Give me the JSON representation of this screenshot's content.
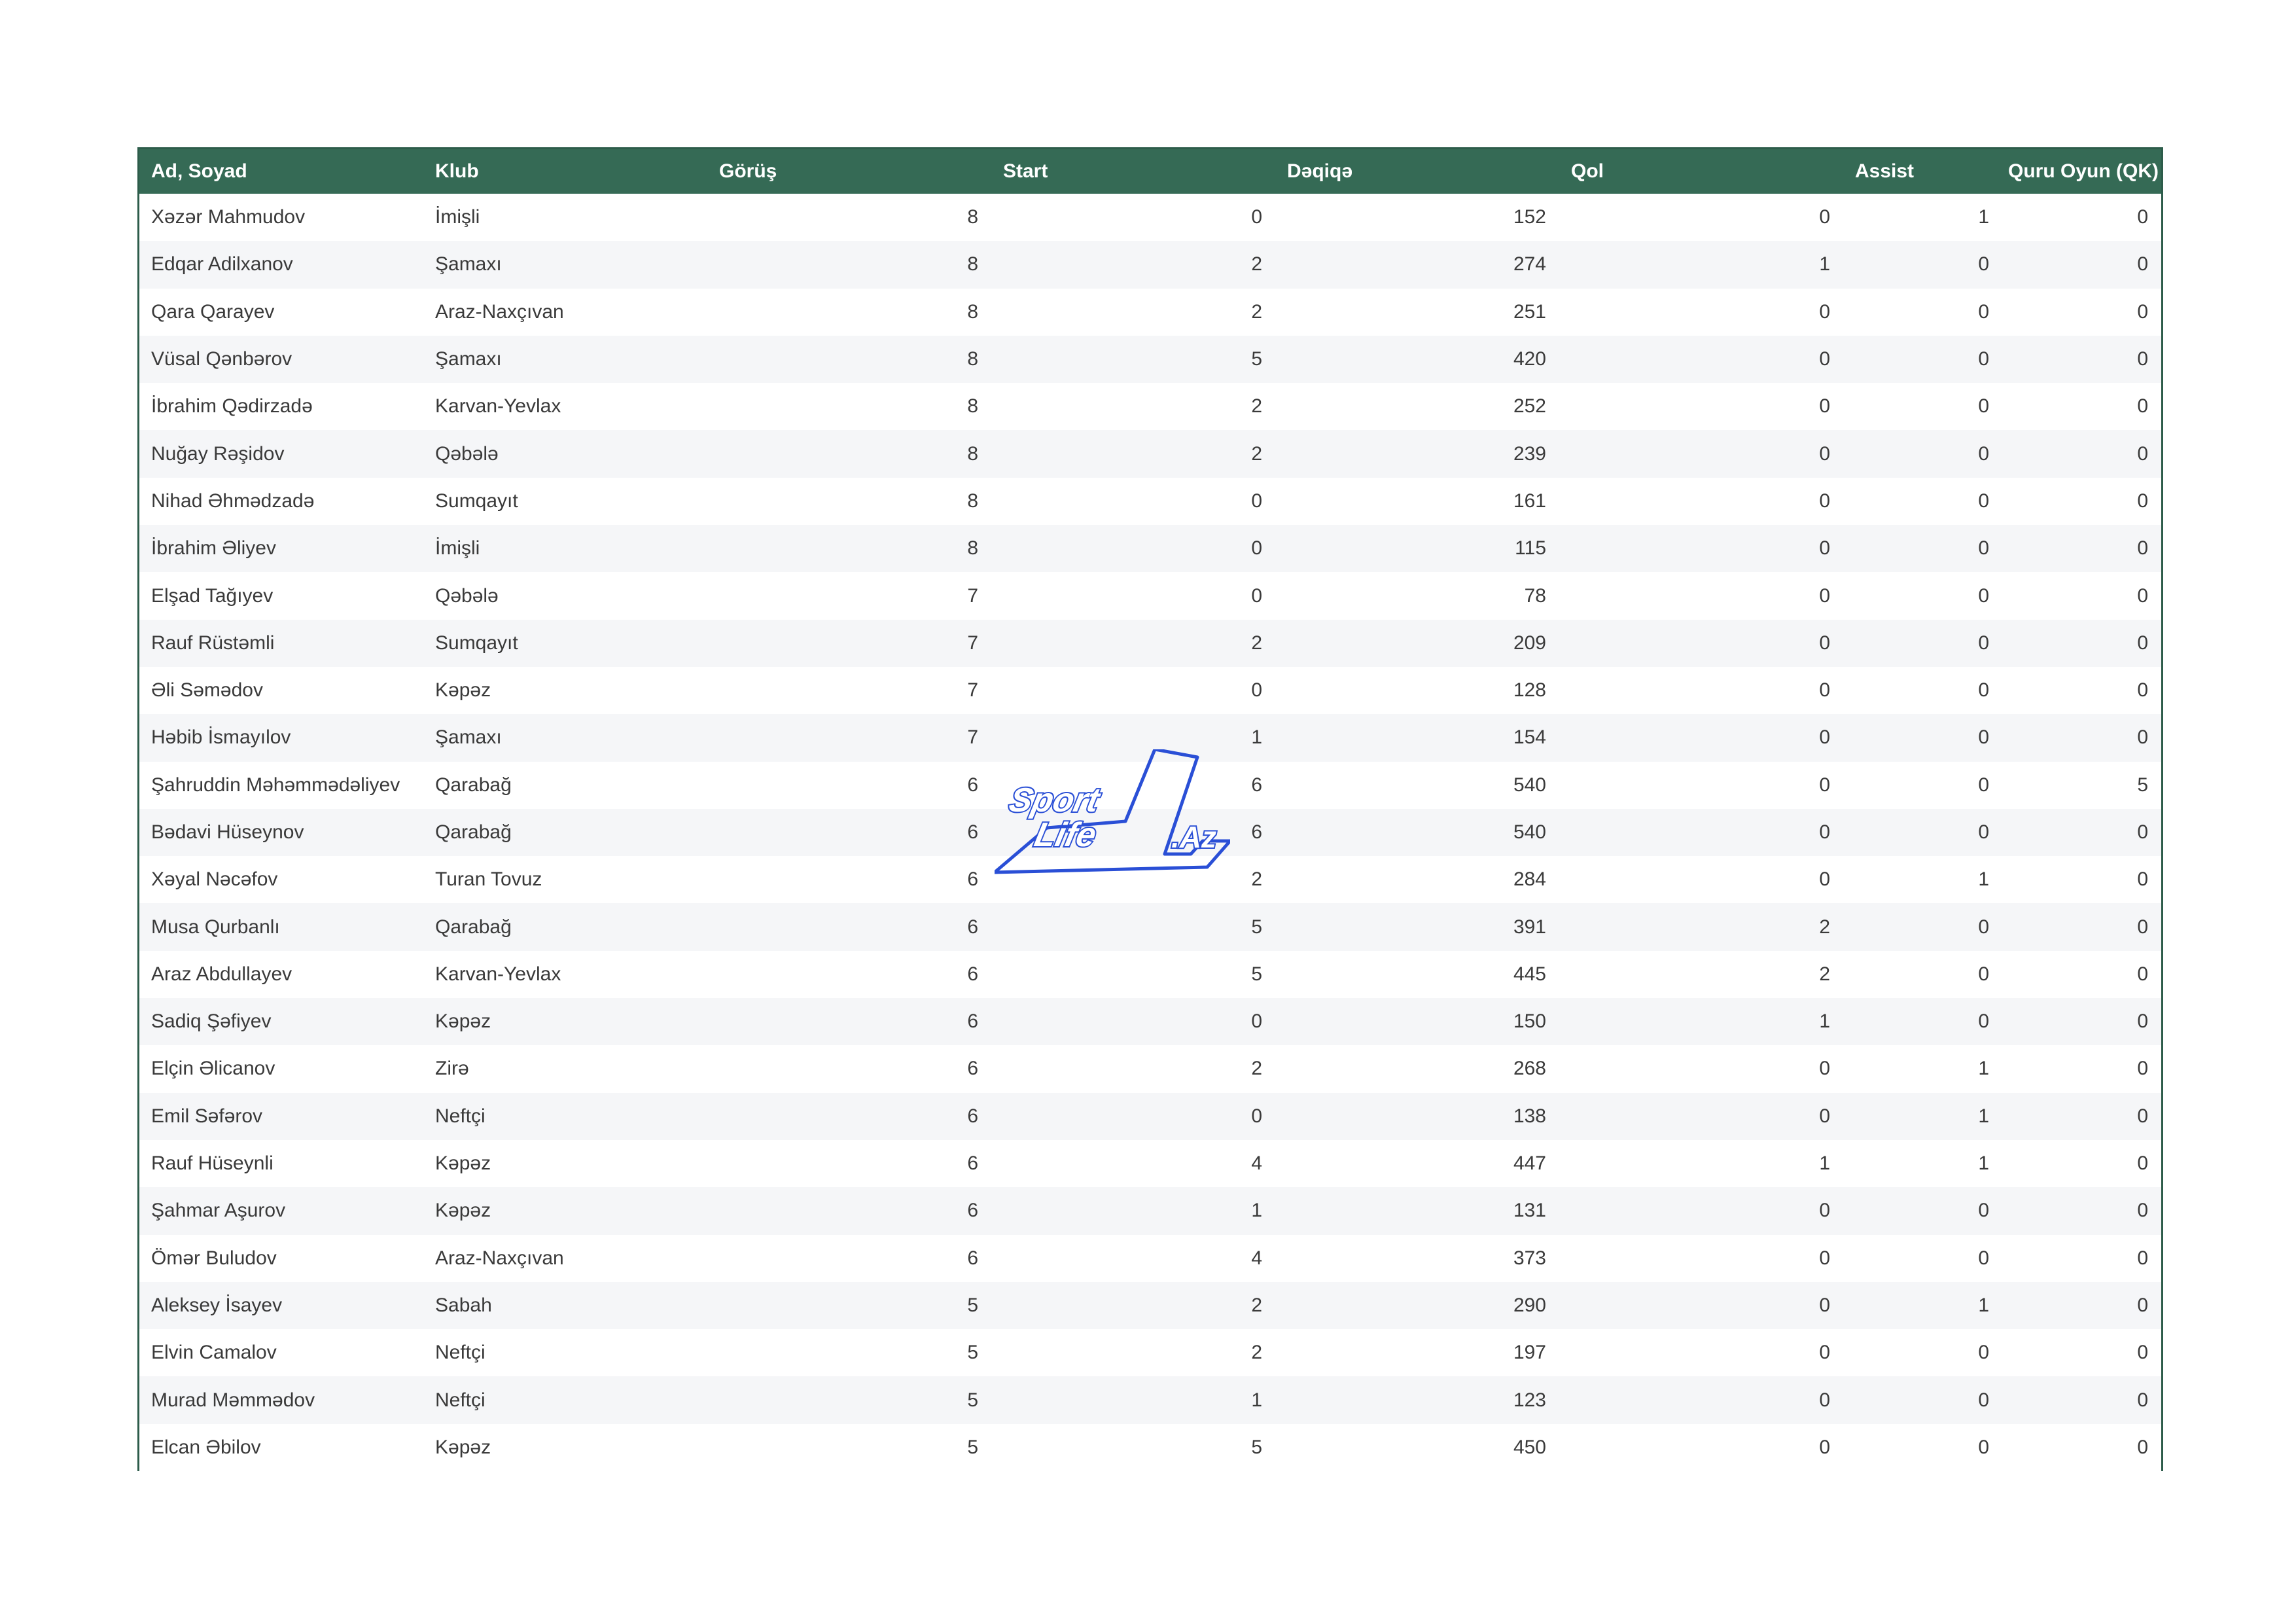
{
  "table": {
    "headers": [
      "Ad, Soyad",
      "Klub",
      "Görüş",
      "Start",
      "Dəqiqə",
      "Qol",
      "Assist",
      "Quru Oyun (QK)"
    ],
    "rows": [
      [
        "Xəzər Mahmudov",
        "İmişli",
        "8",
        "0",
        "152",
        "0",
        "1",
        "0"
      ],
      [
        "Edqar Adilxanov",
        "Şamaxı",
        "8",
        "2",
        "274",
        "1",
        "0",
        "0"
      ],
      [
        "Qara Qarayev",
        "Araz-Naxçıvan",
        "8",
        "2",
        "251",
        "0",
        "0",
        "0"
      ],
      [
        "Vüsal Qənbərov",
        "Şamaxı",
        "8",
        "5",
        "420",
        "0",
        "0",
        "0"
      ],
      [
        "İbrahim Qədirzadə",
        "Karvan-Yevlax",
        "8",
        "2",
        "252",
        "0",
        "0",
        "0"
      ],
      [
        "Nuğay Rəşidov",
        "Qəbələ",
        "8",
        "2",
        "239",
        "0",
        "0",
        "0"
      ],
      [
        "Nihad Əhmədzadə",
        "Sumqayıt",
        "8",
        "0",
        "161",
        "0",
        "0",
        "0"
      ],
      [
        "İbrahim Əliyev",
        "İmişli",
        "8",
        "0",
        "115",
        "0",
        "0",
        "0"
      ],
      [
        "Elşad Tağıyev",
        "Qəbələ",
        "7",
        "0",
        "78",
        "0",
        "0",
        "0"
      ],
      [
        "Rauf Rüstəmli",
        "Sumqayıt",
        "7",
        "2",
        "209",
        "0",
        "0",
        "0"
      ],
      [
        "Əli Səmədov",
        "Kəpəz",
        "7",
        "0",
        "128",
        "0",
        "0",
        "0"
      ],
      [
        "Həbib İsmayılov",
        "Şamaxı",
        "7",
        "1",
        "154",
        "0",
        "0",
        "0"
      ],
      [
        "Şahruddin Məhəmmədəliyev",
        "Qarabağ",
        "6",
        "6",
        "540",
        "0",
        "0",
        "5"
      ],
      [
        "Bədavi Hüseynov",
        "Qarabağ",
        "6",
        "6",
        "540",
        "0",
        "0",
        "0"
      ],
      [
        "Xəyal Nəcəfov",
        "Turan Tovuz",
        "6",
        "2",
        "284",
        "0",
        "1",
        "0"
      ],
      [
        "Musa Qurbanlı",
        "Qarabağ",
        "6",
        "5",
        "391",
        "2",
        "0",
        "0"
      ],
      [
        "Araz Abdullayev",
        "Karvan-Yevlax",
        "6",
        "5",
        "445",
        "2",
        "0",
        "0"
      ],
      [
        "Sadiq Şəfiyev",
        "Kəpəz",
        "6",
        "0",
        "150",
        "1",
        "0",
        "0"
      ],
      [
        "Elçin Əlicanov",
        "Zirə",
        "6",
        "2",
        "268",
        "0",
        "1",
        "0"
      ],
      [
        "Emil Səfərov",
        "Neftçi",
        "6",
        "0",
        "138",
        "0",
        "1",
        "0"
      ],
      [
        "Rauf Hüseynli",
        "Kəpəz",
        "6",
        "4",
        "447",
        "1",
        "1",
        "0"
      ],
      [
        "Şahmar Aşurov",
        "Kəpəz",
        "6",
        "1",
        "131",
        "0",
        "0",
        "0"
      ],
      [
        "Ömər Buludov",
        "Araz-Naxçıvan",
        "6",
        "4",
        "373",
        "0",
        "0",
        "0"
      ],
      [
        "Aleksey İsayev",
        "Sabah",
        "5",
        "2",
        "290",
        "0",
        "1",
        "0"
      ],
      [
        "Elvin Camalov",
        "Neftçi",
        "5",
        "2",
        "197",
        "0",
        "0",
        "0"
      ],
      [
        "Murad Məmmədov",
        "Neftçi",
        "5",
        "1",
        "123",
        "0",
        "0",
        "0"
      ],
      [
        "Elcan Əbilov",
        "Kəpəz",
        "5",
        "5",
        "450",
        "0",
        "0",
        "0"
      ]
    ]
  },
  "watermark": {
    "line1": "Sport",
    "line2": "Life",
    "numeral": "1",
    "suffix": ".Az",
    "color": "#2a4fd6"
  },
  "colors": {
    "header_bg": "#356a55",
    "header_text": "#ffffff",
    "stripe": "#f5f6f8"
  }
}
